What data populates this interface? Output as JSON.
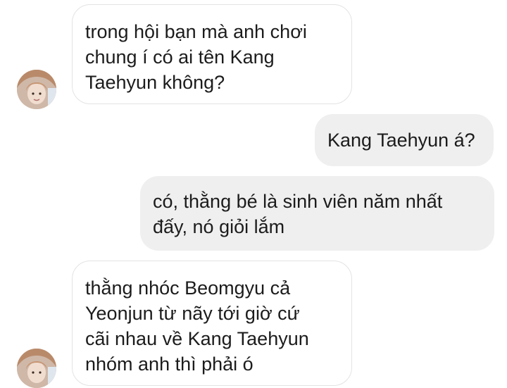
{
  "colors": {
    "received_bubble_bg": "#ffffff",
    "received_bubble_border": "#e3e3e3",
    "sent_bubble_bg": "#efefef",
    "text": "#1c1c1c"
  },
  "avatar": {
    "icon": "user-avatar-photo"
  },
  "messages": [
    {
      "sender": "other",
      "text": "trong hội bạn mà anh chơi\nchung í có ai tên Kang\nTaehyun không?"
    },
    {
      "sender": "me",
      "text": "Kang Taehyun á?"
    },
    {
      "sender": "me",
      "text": "có, thằng bé là sinh viên năm nhất\nđấy, nó giỏi lắm"
    },
    {
      "sender": "other",
      "text": "thằng nhóc Beomgyu cả\nYeonjun từ nãy tới giờ cứ\ncãi nhau về Kang Taehyun\nnhóm anh thì phải ó"
    }
  ]
}
